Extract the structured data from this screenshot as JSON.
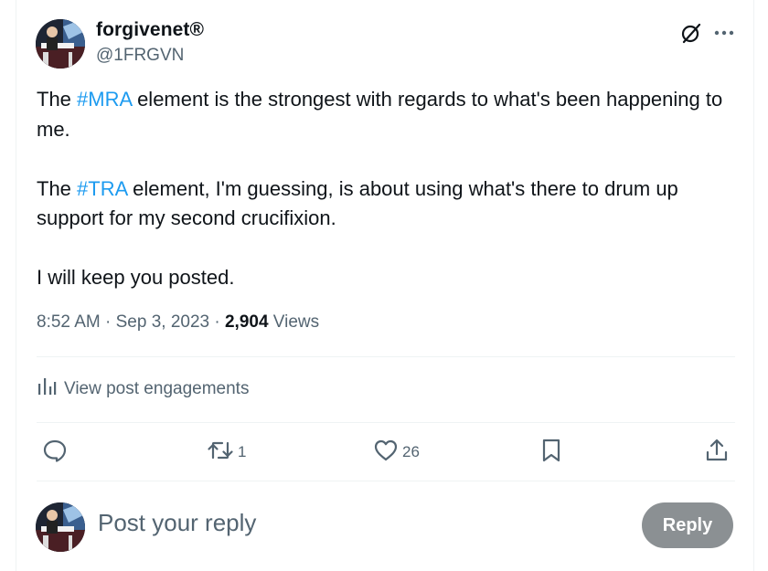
{
  "author": {
    "display_name": "forgivenet®",
    "handle": "@1FRGVN"
  },
  "post": {
    "p1_pre": "The ",
    "p1_tag": "#MRA",
    "p1_post": " element is the strongest with regards to what's been happening to me.",
    "p2_pre": "The ",
    "p2_tag": "#TRA",
    "p2_post": " element, I'm guessing, is about using what's there to drum up support for my second crucifixion.",
    "p3": "I will keep you posted."
  },
  "meta": {
    "time": "8:52 AM",
    "dot1": " · ",
    "date": "Sep 3, 2023",
    "dot2": " · ",
    "views_count": "2,904",
    "views_label": " Views"
  },
  "engagements": {
    "label": "View post engagements"
  },
  "actions": {
    "reply_count": "",
    "repost_count": "1",
    "like_count": "26"
  },
  "reply_box": {
    "placeholder": "Post your reply",
    "button_label": "Reply"
  },
  "colors": {
    "accent": "#1d9bf0",
    "muted": "#536471",
    "reply_button": "#8b9093"
  },
  "icons": [
    "grok-icon",
    "more-icon",
    "analytics-icon",
    "reply-icon",
    "repost-icon",
    "like-icon",
    "bookmark-icon",
    "share-icon"
  ]
}
